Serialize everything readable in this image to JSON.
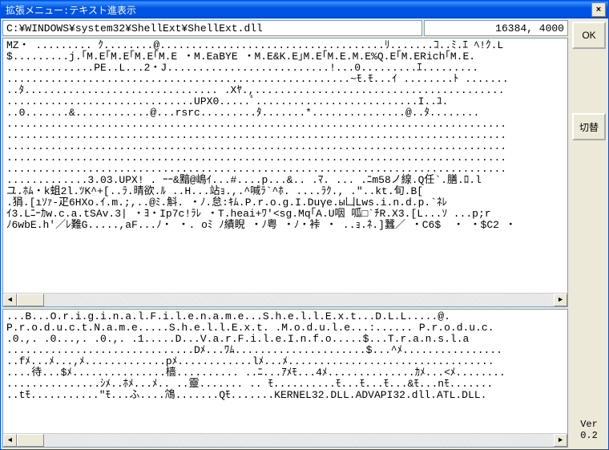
{
  "title": "拡張メニュー:テキスト進表示",
  "path": "C:¥WINDOWS¥system32¥ShellExt¥ShellExt.dll",
  "size_info": "16384, 4000",
  "buttons": {
    "ok": "OK",
    "switch": "切替",
    "close": "×"
  },
  "version": "Ver\n0.2",
  "pane1_lines": [
    "MZ・ ......... ｸ........@....................................ﾘ.......ｺ..ﾐ.ｴ ﾍ!ｸ.L",
    "$.........j.｢M.E｢M.E｢M.E｢M.E ・M.EaBYE ・M.E&K.E｣M.E｢M.E.M.E%Q.E｢M.ERich｢M.E.",
    "..............PE..L...2・J..........................!...0.........ｴ.........",
    ".......................................................~ﾓ.ﾓ...ｲ ........ﾄ .......",
    "..ﾀ............................... .Xﾔ.,........................................",
    "..............................UPX0.....ﾟ..........................I..ﾕ.",
    "..0.......&............@...rsrc.........ﾀ.......*...............@..ﾀ........",
    "................................................................................",
    "................................................................................",
    "................................................................................",
    "................................................................................",
    "................................................................................",
    ".............3.03.UPX! . ｰｰ&黯@嶋ｲ...#....p...&.. .ﾏ. ... .ﾆm58ノ線.Q任`.膳.ﾛ.l",
    "ユ.ﾎﾑ・k蛆2l.ﾂK^+[..ﾗ.晴欲.ﾙ ..H...站ｮ.,.^喊ﾗ`^ﾎ. ....ﾗｸ., .\"..kt.旬.B[",
    ".狷.[ıｿｧ-疋6HXo.ｲ.m.;,..@ﾐ.斛. ・ﾉ.怠:ｷﾑ.P.r.o.g.I.Duγe.ы凵Lws.i.n.d.p.`ﾈﾚ",
    "ｲ3.Lﾆｰｶw.c.a.tSAv.3| ・ﾖ・Ip7c!ﾗﾚ ・T.heai+ﾜ'<sg.Mq｢A.U咽 呱□`ﾁR.X3.[L...ｿ ...p;r",
    "ﾉ6wbE.h'／ﾚ難G.....,аF...ﾉ・ ・. оﾐ ﾉ績睨 ・ﾉ粤 ・ﾉ・裃 ・ ..ｮ.ﾈ.]蠶／ ・C6$  ・ ・$C2 ・"
  ],
  "pane2_lines": [
    "...B...O.r.i.g.i.n.a.l.F.i.l.e.n.a.m.e...S.h.e.l.l.E.x.t...D.L.L.....@.",
    "P.r.o.d.u.c.t.N.a.m.e.....S.h.e.l.l.E.x.t. .M.o.d.u.l.e...:...... P.r.o.d.u.c.",
    ".0.,. .0...,. .0.,. .1.....D...V.a.r.F.i.l.e.I.n.f.o.....$...T.r.a.n.s.l.a",
    "..............................Dﾒ...ﾜﾑ.....................$...^ﾒ................",
    "..fﾒ...ﾒ...,ﾒ.............pﾒ............lﾒ...ﾒ.................................",
    "....待...$ﾒ...............樯.......... ..ﾆ...ｱﾒﾓ...4ﾒ..............ｶﾒ...<ﾒ........",
    "...............ｼﾒ..ﾎﾒ...ﾒ.. ..靈....... .. ﾓ..........ﾓ...ﾓ...ﾓ...&ﾓ...nﾓ.......",
    "..tﾓ...........\"ﾓ...ふ....鴪.......Qﾓ.......KERNEL32.DLL.ADVAPI32.dll.ATL.DLL."
  ]
}
